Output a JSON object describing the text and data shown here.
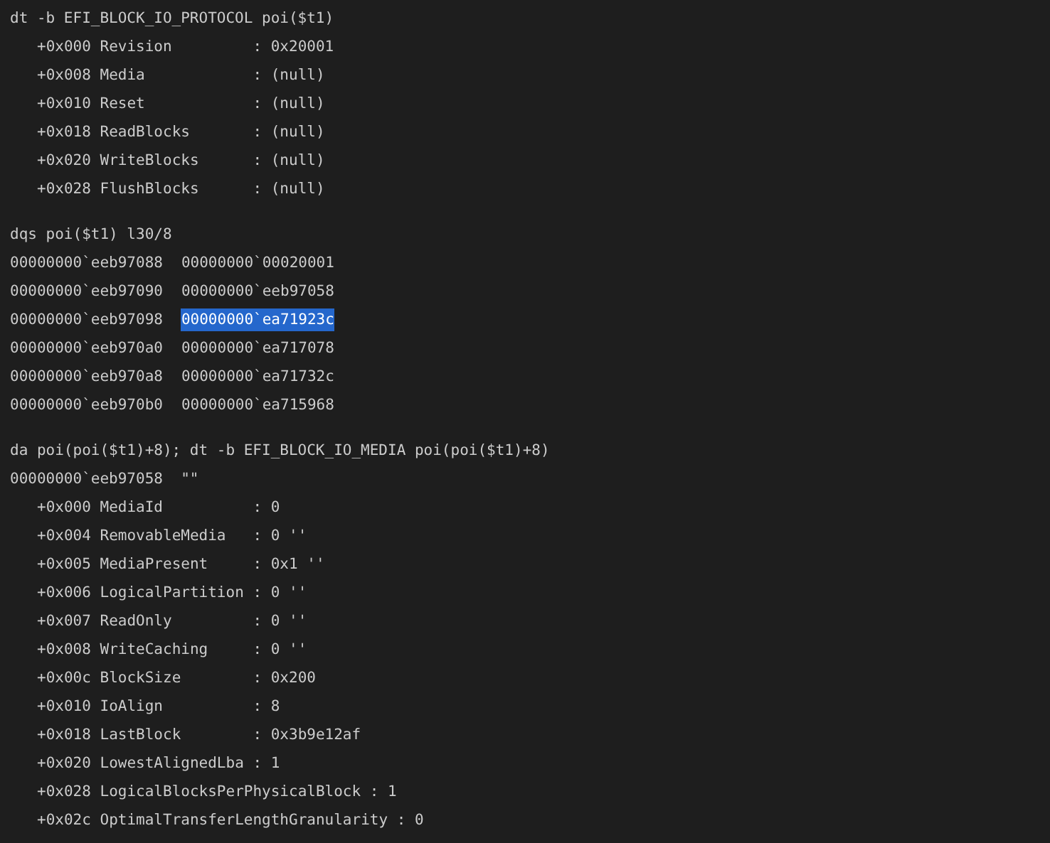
{
  "blocks": [
    {
      "command": "dt -b EFI_BLOCK_IO_PROTOCOL poi($t1)",
      "lines": [
        {
          "kind": "field",
          "text": "+0x000 Revision         : 0x20001"
        },
        {
          "kind": "field",
          "text": "+0x008 Media            : (null)"
        },
        {
          "kind": "field",
          "text": "+0x010 Reset            : (null)"
        },
        {
          "kind": "field",
          "text": "+0x018 ReadBlocks       : (null)"
        },
        {
          "kind": "field",
          "text": "+0x020 WriteBlocks      : (null)"
        },
        {
          "kind": "field",
          "text": "+0x028 FlushBlocks      : (null)"
        }
      ]
    },
    {
      "command": "dqs poi($t1) l30/8",
      "lines": [
        {
          "kind": "dump",
          "address": "00000000`eeb97088",
          "value": "00000000`00020001",
          "selected": false
        },
        {
          "kind": "dump",
          "address": "00000000`eeb97090",
          "value": "00000000`eeb97058",
          "selected": false
        },
        {
          "kind": "dump",
          "address": "00000000`eeb97098",
          "value": "00000000`ea71923c",
          "selected": true
        },
        {
          "kind": "dump",
          "address": "00000000`eeb970a0",
          "value": "00000000`ea717078",
          "selected": false
        },
        {
          "kind": "dump",
          "address": "00000000`eeb970a8",
          "value": "00000000`ea71732c",
          "selected": false
        },
        {
          "kind": "dump",
          "address": "00000000`eeb970b0",
          "value": "00000000`ea715968",
          "selected": false
        }
      ]
    },
    {
      "command": "da poi(poi($t1)+8); dt -b EFI_BLOCK_IO_MEDIA poi(poi($t1)+8)",
      "lines": [
        {
          "kind": "text",
          "text": "00000000`eeb97058  \"\""
        },
        {
          "kind": "field",
          "text": "+0x000 MediaId          : 0"
        },
        {
          "kind": "field",
          "text": "+0x004 RemovableMedia   : 0 ''"
        },
        {
          "kind": "field",
          "text": "+0x005 MediaPresent     : 0x1 ''"
        },
        {
          "kind": "field",
          "text": "+0x006 LogicalPartition : 0 ''"
        },
        {
          "kind": "field",
          "text": "+0x007 ReadOnly         : 0 ''"
        },
        {
          "kind": "field",
          "text": "+0x008 WriteCaching     : 0 ''"
        },
        {
          "kind": "field",
          "text": "+0x00c BlockSize        : 0x200"
        },
        {
          "kind": "field",
          "text": "+0x010 IoAlign          : 8"
        },
        {
          "kind": "field",
          "text": "+0x018 LastBlock        : 0x3b9e12af"
        },
        {
          "kind": "field",
          "text": "+0x020 LowestAlignedLba : 1"
        },
        {
          "kind": "field",
          "text": "+0x028 LogicalBlocksPerPhysicalBlock : 1"
        },
        {
          "kind": "field",
          "text": "+0x02c OptimalTransferLengthGranularity : 0"
        }
      ]
    }
  ]
}
